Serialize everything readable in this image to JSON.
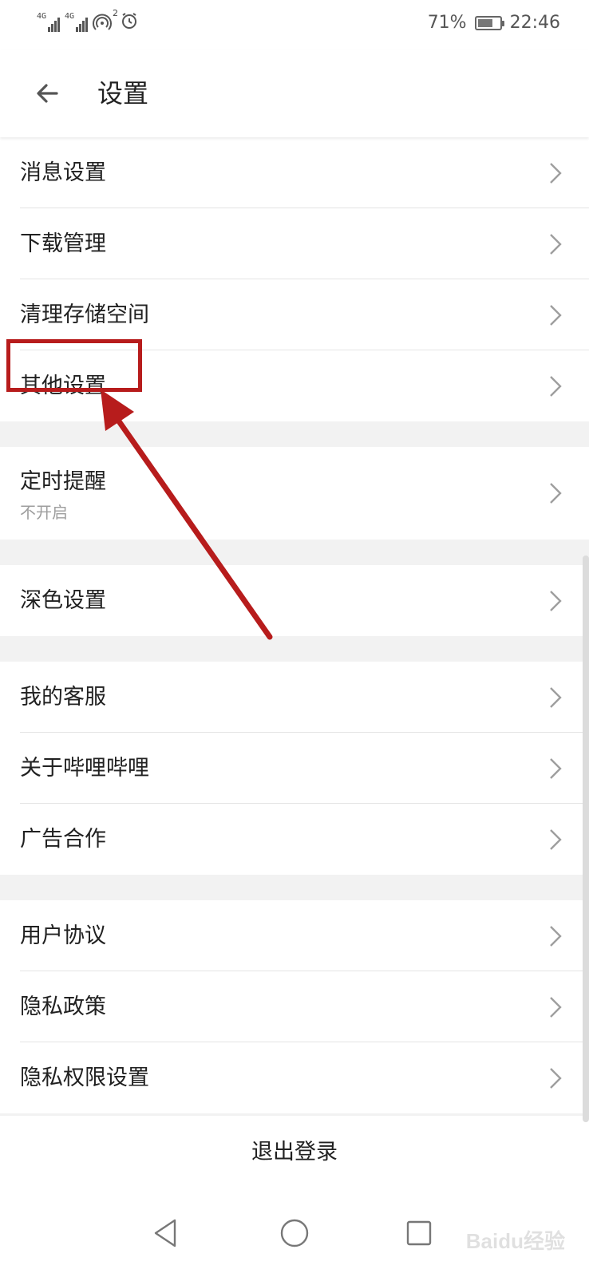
{
  "status_bar": {
    "network_1": "4G",
    "network_2": "4G",
    "hotspot_count": "2",
    "battery_percent": "71%",
    "battery_level": 0.71,
    "time": "22:46"
  },
  "app_bar": {
    "title": "设置",
    "back_icon": "arrow-left-icon"
  },
  "settings": {
    "group1": [
      {
        "label": "消息设置"
      },
      {
        "label": "下载管理"
      },
      {
        "label": "清理存储空间"
      },
      {
        "label": "其他设置"
      }
    ],
    "reminder": {
      "label": "定时提醒",
      "value": "不开启"
    },
    "dark_mode": {
      "label": "深色设置"
    },
    "group3": [
      {
        "label": "我的客服"
      },
      {
        "label": "关于哔哩哔哩"
      },
      {
        "label": "广告合作"
      }
    ],
    "group4": [
      {
        "label": "用户协议"
      },
      {
        "label": "隐私政策"
      },
      {
        "label": "隐私权限设置"
      }
    ],
    "chevron_icon": "chevron-right-icon"
  },
  "logout": {
    "label": "退出登录"
  },
  "nav_bar": {
    "back": "triangle-back-icon",
    "home": "circle-home-icon",
    "recents": "square-recents-icon"
  },
  "annotation": {
    "highlight_color": "#b71c1c",
    "target": "其他设置"
  },
  "watermark": {
    "text": "Baidu经验"
  }
}
